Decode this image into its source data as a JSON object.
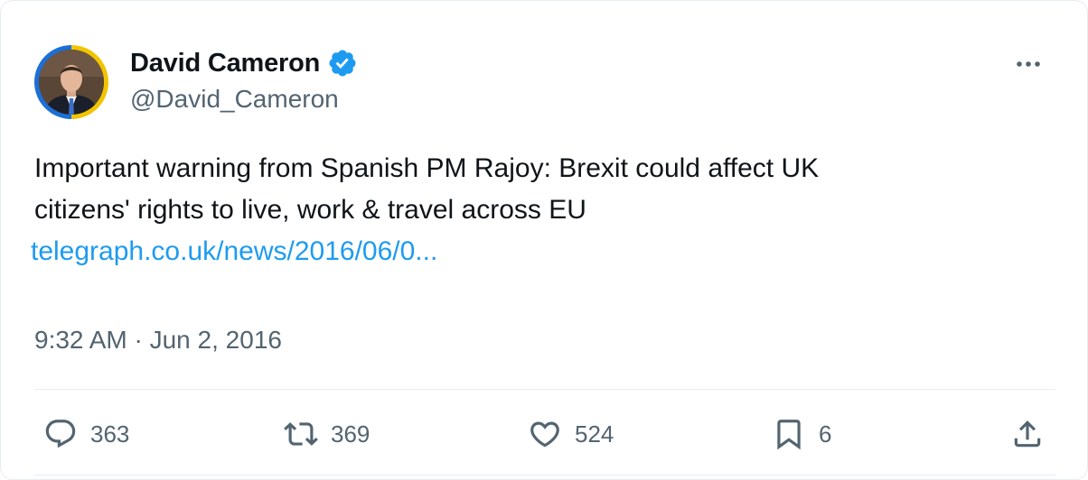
{
  "tweet": {
    "author": {
      "display_name": "David Cameron",
      "handle": "@David_Cameron",
      "verified": true,
      "verified_color": "#1d9bf0",
      "avatar_ring_colors": [
        "#f2c400",
        "#1c6fd6"
      ]
    },
    "text_line_1": "Important warning from Spanish PM Rajoy: Brexit could affect UK",
    "text_line_2": "citizens' rights to live, work & travel across EU",
    "link_text": "telegraph.co.uk/news/2016/06/0...",
    "timestamp": "9:32 AM · Jun 2, 2016",
    "more_icon": "more-horizontal-icon"
  },
  "actions": {
    "reply": {
      "icon": "reply-icon",
      "count": "363"
    },
    "retweet": {
      "icon": "retweet-icon",
      "count": "369"
    },
    "like": {
      "icon": "heart-icon",
      "count": "524"
    },
    "bookmark": {
      "icon": "bookmark-icon",
      "count": "6"
    },
    "share": {
      "icon": "share-icon"
    }
  },
  "colors": {
    "text": "#0f1419",
    "secondary": "#536471",
    "link": "#1d9bf0",
    "divider": "#e6ecf0"
  }
}
